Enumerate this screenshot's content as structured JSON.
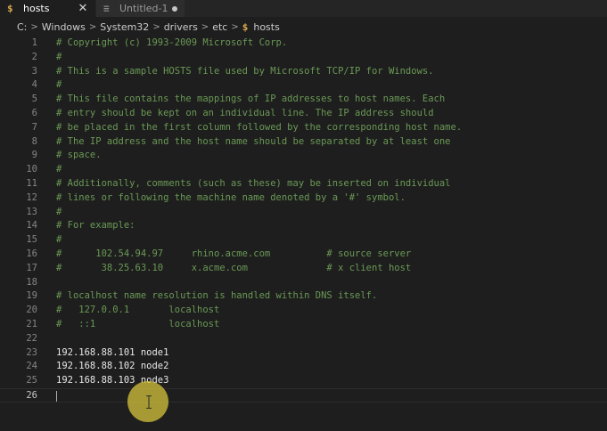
{
  "tabs": [
    {
      "icon": "$",
      "label": "hosts",
      "active": true,
      "close_glyph": "✕"
    },
    {
      "icon": "≡",
      "label": "Untitled-1",
      "active": false,
      "dirty": true
    }
  ],
  "breadcrumb": {
    "segments": [
      "C:",
      "Windows",
      "System32",
      "drivers",
      "etc"
    ],
    "separator": ">",
    "file_icon": "$",
    "file": "hosts"
  },
  "editor": {
    "current_line": 26,
    "lines": [
      {
        "num": "1",
        "text": "# Copyright (c) 1993-2009 Microsoft Corp.",
        "kind": "comment"
      },
      {
        "num": "2",
        "text": "#",
        "kind": "comment"
      },
      {
        "num": "3",
        "text": "# This is a sample HOSTS file used by Microsoft TCP/IP for Windows.",
        "kind": "comment"
      },
      {
        "num": "4",
        "text": "#",
        "kind": "comment"
      },
      {
        "num": "5",
        "text": "# This file contains the mappings of IP addresses to host names. Each",
        "kind": "comment"
      },
      {
        "num": "6",
        "text": "# entry should be kept on an individual line. The IP address should",
        "kind": "comment"
      },
      {
        "num": "7",
        "text": "# be placed in the first column followed by the corresponding host name.",
        "kind": "comment"
      },
      {
        "num": "8",
        "text": "# The IP address and the host name should be separated by at least one",
        "kind": "comment"
      },
      {
        "num": "9",
        "text": "# space.",
        "kind": "comment"
      },
      {
        "num": "10",
        "text": "#",
        "kind": "comment"
      },
      {
        "num": "11",
        "text": "# Additionally, comments (such as these) may be inserted on individual",
        "kind": "comment"
      },
      {
        "num": "12",
        "text": "# lines or following the machine name denoted by a '#' symbol.",
        "kind": "comment"
      },
      {
        "num": "13",
        "text": "#",
        "kind": "comment"
      },
      {
        "num": "14",
        "text": "# For example:",
        "kind": "comment"
      },
      {
        "num": "15",
        "text": "#",
        "kind": "comment"
      },
      {
        "num": "16",
        "text": "#      102.54.94.97     rhino.acme.com          # source server",
        "kind": "comment"
      },
      {
        "num": "17",
        "text": "#       38.25.63.10     x.acme.com              # x client host",
        "kind": "comment"
      },
      {
        "num": "18",
        "text": "",
        "kind": "comment"
      },
      {
        "num": "19",
        "text": "# localhost name resolution is handled within DNS itself.",
        "kind": "comment"
      },
      {
        "num": "20",
        "text": "#   127.0.0.1       localhost",
        "kind": "comment"
      },
      {
        "num": "21",
        "text": "#   ::1             localhost",
        "kind": "comment"
      },
      {
        "num": "22",
        "text": "",
        "kind": "plain"
      },
      {
        "num": "23",
        "text": "192.168.88.101 node1",
        "kind": "plain"
      },
      {
        "num": "24",
        "text": "192.168.88.102 node2",
        "kind": "plain"
      },
      {
        "num": "25",
        "text": "192.168.88.103 node3",
        "kind": "plain"
      },
      {
        "num": "26",
        "text": "",
        "kind": "plain"
      }
    ]
  },
  "colors": {
    "background": "#1e1e1e",
    "comment": "#6a9955",
    "line_number": "#858585",
    "file_icon": "#d6a74c",
    "pointer_highlight": "#d6c43c"
  },
  "icons": {
    "hosts_tab": "shell-file-icon",
    "untitled_tab": "text-file-icon",
    "close": "close-icon",
    "dirty": "unsaved-dot-icon",
    "pointer": "text-cursor-icon"
  }
}
